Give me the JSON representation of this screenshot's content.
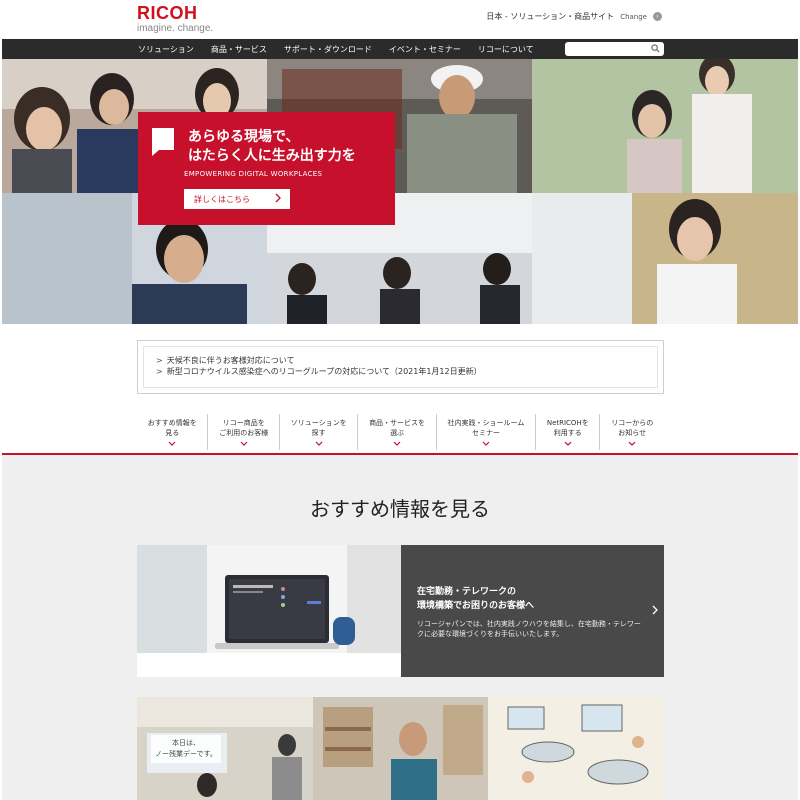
{
  "header": {
    "logo": "RICOH",
    "tagline": "imagine. change.",
    "site_label": "日本 - ソリューション・商品サイト",
    "change_label": "Change"
  },
  "nav": {
    "items": [
      {
        "label": "ソリューション"
      },
      {
        "label": "商品・サービス"
      },
      {
        "label": "サポート・ダウンロード"
      },
      {
        "label": "イベント・セミナー"
      },
      {
        "label": "リコーについて"
      }
    ],
    "search_placeholder": ""
  },
  "hero": {
    "title_line1": "あらゆる現場で、",
    "title_line2": "はたらく人に生み出す力を",
    "subtitle": "EMPOWERING DIGITAL WORKPLACES",
    "button_label": "詳しくはこちら"
  },
  "notices": [
    {
      "text": "天候不良に伴うお客様対応について"
    },
    {
      "text": "新型コロナウイルス感染症へのリコーグループの対応について（2021年1月12日更新）"
    }
  ],
  "subnav": [
    {
      "line1": "おすすめ情報を",
      "line2": "見る"
    },
    {
      "line1": "リコー商品を",
      "line2": "ご利用のお客様"
    },
    {
      "line1": "ソリューションを",
      "line2": "探す"
    },
    {
      "line1": "商品・サービスを",
      "line2": "選ぶ"
    },
    {
      "line1": "社内実践・ショールーム",
      "line2": "セミナー"
    },
    {
      "line1": "NetRICOHを",
      "line2": "利用する"
    },
    {
      "line1": "リコーからの",
      "line2": "お知らせ"
    }
  ],
  "section": {
    "title": "おすすめ情報を見る"
  },
  "feature": {
    "title_line1": "在宅勤務・テレワークの",
    "title_line2": "環境構築でお困りのお客様へ",
    "description": "リコージャパンでは、社内実践ノウハウを結集し、在宅勤務・テレワークに必要な環境づくりをお手伝いいたします。"
  },
  "cards": {
    "card1_caption_line1": "本日は、",
    "card1_caption_line2": "ノー残業デーです。"
  },
  "colors": {
    "brand_red": "#c7102b",
    "nav_bg": "#2b2b2b",
    "feature_bg": "#494949",
    "section_bg": "#efefef"
  }
}
